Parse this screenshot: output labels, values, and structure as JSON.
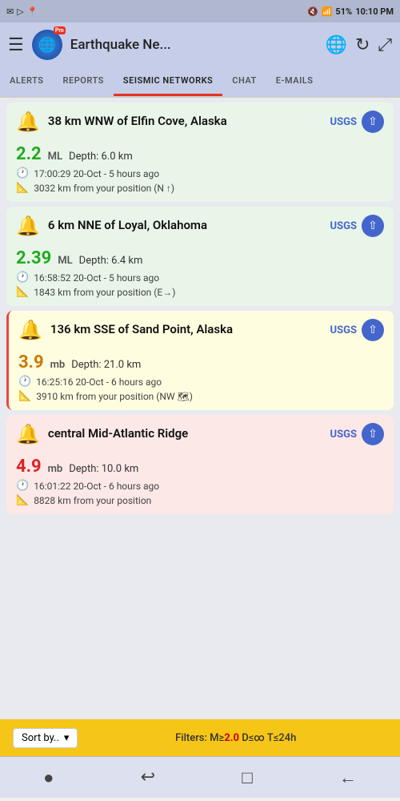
{
  "status_bar": {
    "left_icons": [
      "✉",
      "▷",
      "◎"
    ],
    "location_icon": "📍",
    "right_icons": [
      "🔇",
      "📶"
    ],
    "signal": "..ll",
    "battery": "51%",
    "time": "10:10 PM"
  },
  "header": {
    "title": "Earthquake Ne...",
    "pro_badge": "Pro",
    "menu_icon": "☰",
    "globe_icon": "🌐",
    "refresh_icon": "↻",
    "expand_icon": "⤢"
  },
  "tabs": [
    {
      "id": "alerts",
      "label": "ALERTS",
      "active": false
    },
    {
      "id": "reports",
      "label": "REPORTS",
      "active": false
    },
    {
      "id": "seismic",
      "label": "SEISMIC NETWORKS",
      "active": true
    },
    {
      "id": "chat",
      "label": "CHAT",
      "active": false
    },
    {
      "id": "emails",
      "label": "E-MAILS",
      "active": false
    }
  ],
  "earthquakes": [
    {
      "id": "eq1",
      "icon": "🔔",
      "location": "38 km WNW of Elfin Cove, Alaska",
      "source": "USGS",
      "magnitude": "2.2",
      "unit": "ML",
      "mag_color": "green",
      "depth": "Depth: 6.0 km",
      "time": "17:00:29 20-Oct - 5 hours ago",
      "distance": "3032 km from your position (N ↑)",
      "card_color": "green"
    },
    {
      "id": "eq2",
      "icon": "🔔",
      "location": "6 km NNE of Loyal, Oklahoma",
      "source": "USGS",
      "magnitude": "2.39",
      "unit": "ML",
      "mag_color": "green",
      "depth": "Depth: 6.4 km",
      "time": "16:58:52 20-Oct - 5 hours ago",
      "distance": "1843 km from your position (E→)",
      "card_color": "green"
    },
    {
      "id": "eq3",
      "icon": "🔔",
      "location": "136 km SSE of Sand Point, Alaska",
      "source": "USGS",
      "magnitude": "3.9",
      "unit": "mb",
      "mag_color": "orange",
      "depth": "Depth: 21.0 km",
      "time": "16:25:16 20-Oct - 6 hours ago",
      "distance": "3910 km from your position (NW 🗺)",
      "card_color": "yellow"
    },
    {
      "id": "eq4",
      "icon": "🔔",
      "location": "central Mid-Atlantic Ridge",
      "source": "USGS",
      "magnitude": "4.9",
      "unit": "mb",
      "mag_color": "red",
      "depth": "Depth: 10.0 km",
      "time": "16:01:22 20-Oct - 6 hours ago",
      "distance": "8828 km from your position",
      "card_color": "pink"
    }
  ],
  "bottom_bar": {
    "sort_label": "Sort by..",
    "filter_prefix": "Filters: M≥",
    "filter_magnitude": "2.0",
    "filter_depth": "D≤∞",
    "filter_time": "T≤24h"
  },
  "nav_bottom_icons": [
    "●",
    "↩",
    "□",
    "←"
  ]
}
